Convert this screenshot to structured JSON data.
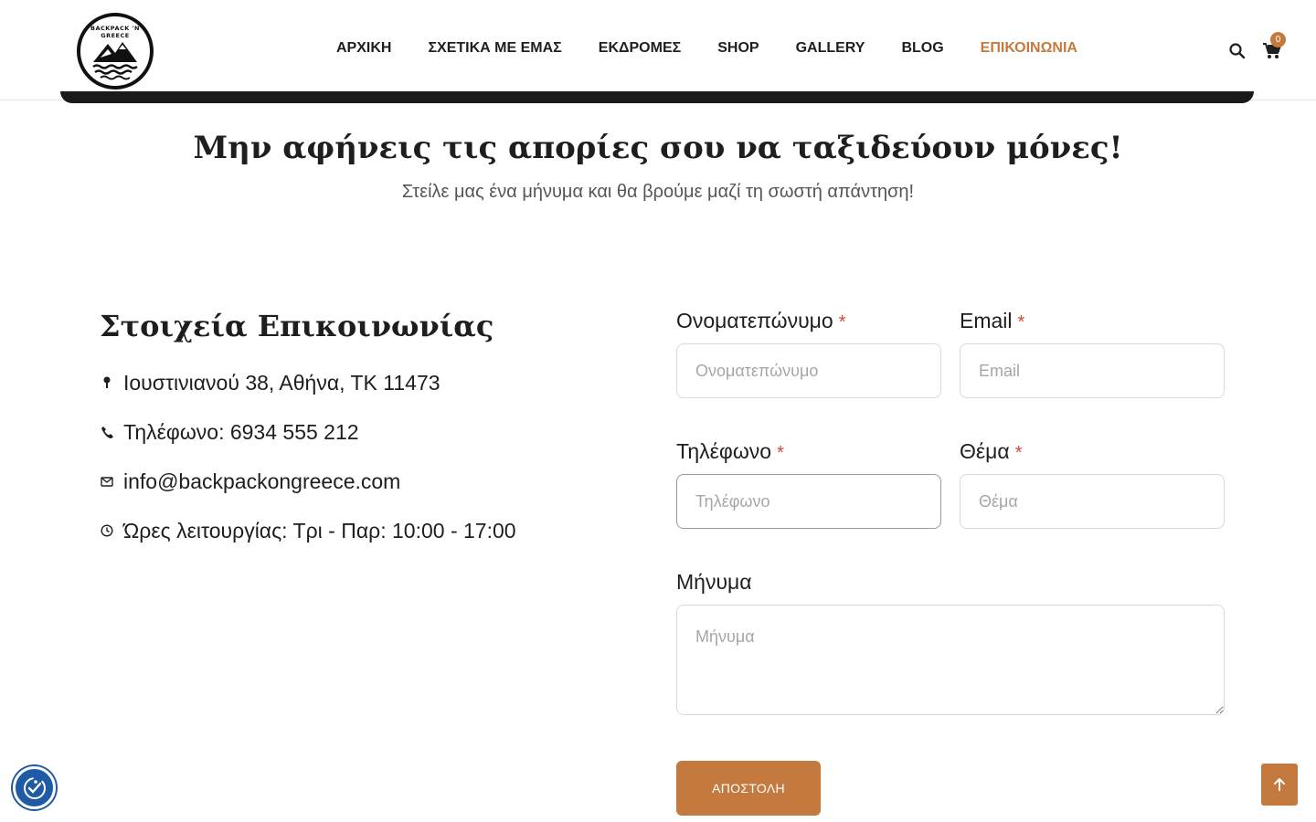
{
  "header": {
    "logo_text": "BACKPACK 'N GREECE",
    "nav": [
      {
        "label": "ΑΡΧΙΚΗ"
      },
      {
        "label": "ΣΧΕΤΙΚΑ ΜΕ ΕΜΑΣ"
      },
      {
        "label": "ΕΚΔΡΟΜΕΣ"
      },
      {
        "label": "SHOP"
      },
      {
        "label": "GALLERY"
      },
      {
        "label": "BLOG"
      },
      {
        "label": "ΕΠΙΚΟΙΝΩΝΙΑ",
        "active": true
      }
    ],
    "cart_count": "0",
    "search_icon": "search-icon",
    "cart_icon": "cart-icon"
  },
  "hero": {
    "title": "Μην αφήνεις τις απορίες σου να ταξιδεύουν μόνες!",
    "subtitle": "Στείλε μας ένα μήνυμα και θα βρούμε μαζί τη σωστή απάντηση!"
  },
  "contact": {
    "title": "Στοιχεία Επικοινωνίας",
    "items": [
      {
        "icon": "map-pin-icon",
        "text": "Ιουστινιανού 38, Αθήνα, ΤΚ 11473"
      },
      {
        "icon": "phone-icon",
        "text": "Τηλέφωνο: 6934 555 212"
      },
      {
        "icon": "mail-icon",
        "text": "info@backpackongreece.com"
      },
      {
        "icon": "clock-icon",
        "text": "Ώρες λειτουργίας: Τρι - Παρ: 10:00 - 17:00"
      }
    ]
  },
  "form": {
    "name": {
      "label": "Ονοματεπώνυμο",
      "required": "*",
      "placeholder": "Ονοματεπώνυμο",
      "value": ""
    },
    "email": {
      "label": "Email",
      "required": "*",
      "placeholder": "Email",
      "value": ""
    },
    "phone": {
      "label": "Τηλέφωνο",
      "required": "*",
      "placeholder": "Τηλέφωνο",
      "value": ""
    },
    "subject": {
      "label": "Θέμα",
      "required": "*",
      "placeholder": "Θέμα",
      "value": ""
    },
    "message": {
      "label": "Μήνυμα",
      "placeholder": "Μήνυμα",
      "value": ""
    },
    "submit_label": "ΑΠΟΣΤΟΛΗ"
  },
  "widgets": {
    "accessibility_icon": "accessibility-icon",
    "scroll_top_icon": "arrow-up-icon"
  },
  "colors": {
    "accent": "#c47a3e",
    "text": "#1e1e1e",
    "required": "#d9443a",
    "accessibility": "#1f5aa6"
  }
}
